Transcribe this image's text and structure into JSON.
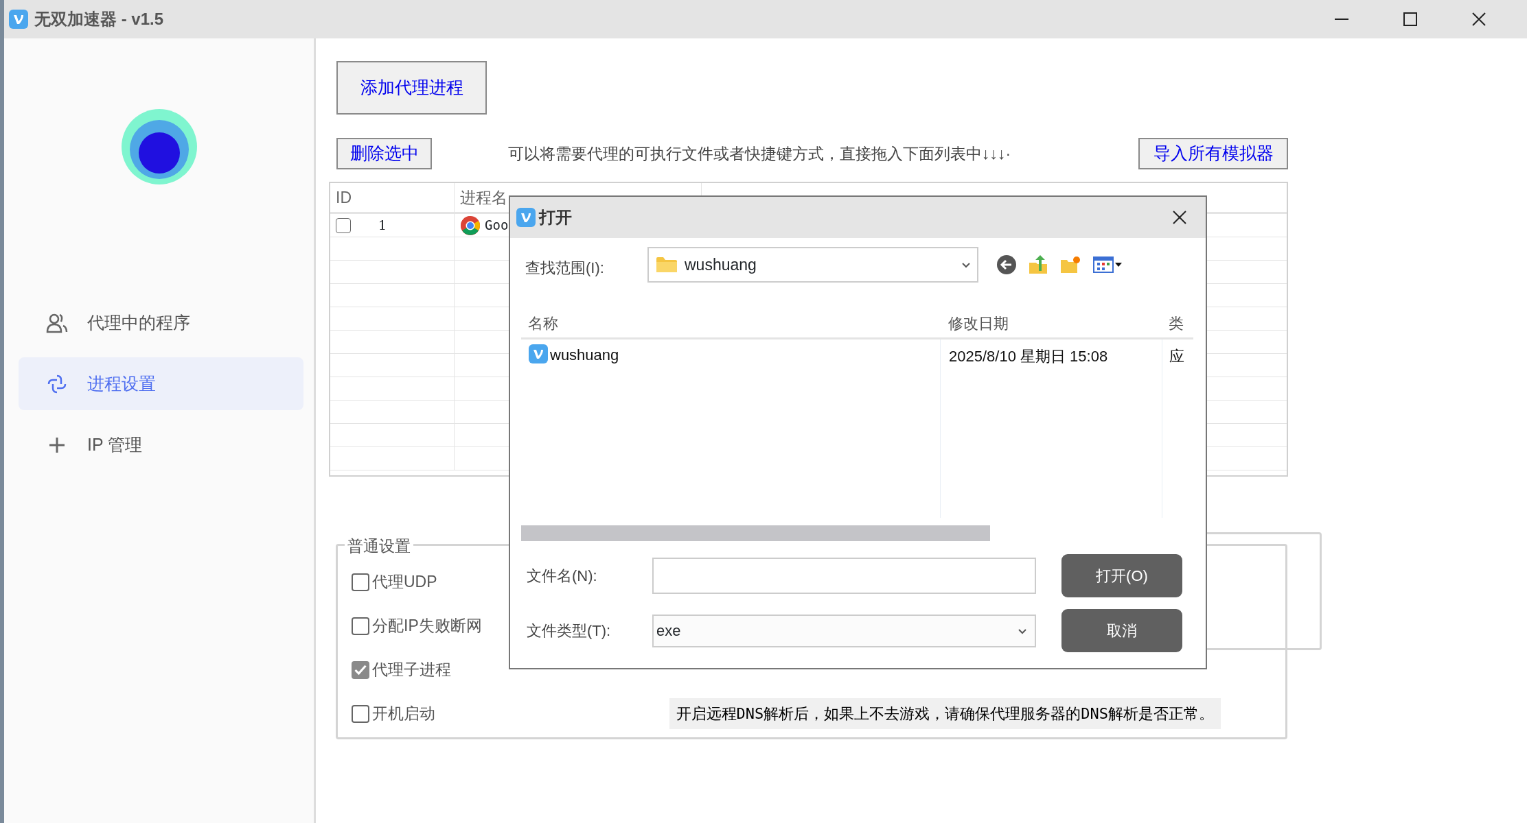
{
  "window": {
    "title": "无双加速器 - v1.5"
  },
  "sidebar": {
    "items": [
      {
        "label": "代理中的程序",
        "selected": false
      },
      {
        "label": "进程设置",
        "selected": true
      },
      {
        "label": "IP 管理",
        "selected": false
      }
    ]
  },
  "toolbar": {
    "add_button": "添加代理进程",
    "delete_button": "删除选中",
    "hint": "可以将需要代理的可执行文件或者快捷键方式，直接拖入下面列表中↓↓↓·",
    "import_button": "导入所有模拟器"
  },
  "table": {
    "columns": [
      "ID",
      "进程名"
    ],
    "rows": [
      {
        "checked": false,
        "id": "1",
        "name": "Goo"
      }
    ]
  },
  "settings": {
    "title": "普通设置",
    "options": [
      {
        "label": "代理UDP",
        "checked": false
      },
      {
        "label": "分配IP失败断网",
        "checked": false
      },
      {
        "label": "代理子进程",
        "checked": true
      },
      {
        "label": "开机启动",
        "checked": false
      }
    ],
    "note": "开启远程DNS解析后，如果上不去游戏，请确保代理服务器的DNS解析是否正常。"
  },
  "dialog": {
    "title": "打开",
    "look_in_label": "查找范围(I):",
    "look_in": "wushuang",
    "columns": [
      "名称",
      "修改日期",
      "类"
    ],
    "files": [
      {
        "name": "wushuang",
        "modified": "2025/8/10 星期日 15:08",
        "type": "应"
      }
    ],
    "file_name_label": "文件名(N):",
    "file_type_label": "文件类型(T):",
    "file_type": "exe",
    "buttons": [
      "打开(O)",
      "取消"
    ]
  }
}
